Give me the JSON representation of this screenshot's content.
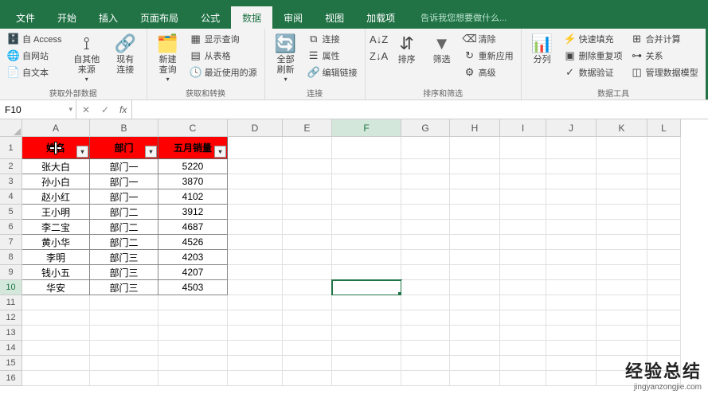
{
  "tabs": {
    "t1": "文件",
    "t2": "开始",
    "t3": "插入",
    "t4": "页面布局",
    "t5": "公式",
    "t6": "数据",
    "t7": "审阅",
    "t8": "视图",
    "t9": "加载项"
  },
  "tellme": "告诉我您想要做什么...",
  "ribbon": {
    "g1": {
      "label": "获取外部数据",
      "access": "自 Access",
      "web": "自网站",
      "text": "自文本",
      "other": "自其他来源",
      "existing": "现有连接"
    },
    "g2": {
      "label": "获取和转换",
      "newq": "新建\n查询",
      "show": "显示查询",
      "table": "从表格",
      "recent": "最近使用的源"
    },
    "g3": {
      "label": "连接",
      "refresh": "全部刷新",
      "conn": "连接",
      "prop": "属性",
      "links": "编辑链接"
    },
    "g4": {
      "label": "排序和筛选",
      "sortAZ": "A↓Z",
      "sortZA": "Z↓A",
      "sort": "排序",
      "filter": "筛选",
      "clear": "清除",
      "reapply": "重新应用",
      "adv": "高级"
    },
    "g5": {
      "label": "数据工具",
      "split": "分列",
      "flash": "快速填充",
      "dup": "删除重复项",
      "valid": "数据验证",
      "consol": "合并计算",
      "rel": "关系",
      "model": "管理数据模型"
    }
  },
  "namebox": "F10",
  "fx_x": "✕",
  "fx_v": "✓",
  "cols": {
    "A": "A",
    "B": "B",
    "C": "C",
    "D": "D",
    "E": "E",
    "F": "F",
    "G": "G",
    "H": "H",
    "I": "I",
    "J": "J",
    "K": "K",
    "L": "L"
  },
  "headers": {
    "name": "姓名",
    "dept": "部门",
    "sales": "五月销量"
  },
  "chart_data": {
    "type": "table",
    "columns": [
      "姓名",
      "部门",
      "五月销量"
    ],
    "rows": [
      {
        "name": "张大白",
        "dept": "部门一",
        "sales": 5220
      },
      {
        "name": "孙小白",
        "dept": "部门一",
        "sales": 3870
      },
      {
        "name": "赵小红",
        "dept": "部门一",
        "sales": 4102
      },
      {
        "name": "王小明",
        "dept": "部门二",
        "sales": 3912
      },
      {
        "name": "李二宝",
        "dept": "部门二",
        "sales": 4687
      },
      {
        "name": "黄小华",
        "dept": "部门二",
        "sales": 4526
      },
      {
        "name": "李明",
        "dept": "部门三",
        "sales": 4203
      },
      {
        "name": "钱小五",
        "dept": "部门三",
        "sales": 4207
      },
      {
        "name": "华安",
        "dept": "部门三",
        "sales": 4503
      }
    ]
  },
  "watermark": {
    "line1": "经验总结",
    "line2": "jingyanzongjie.com"
  }
}
